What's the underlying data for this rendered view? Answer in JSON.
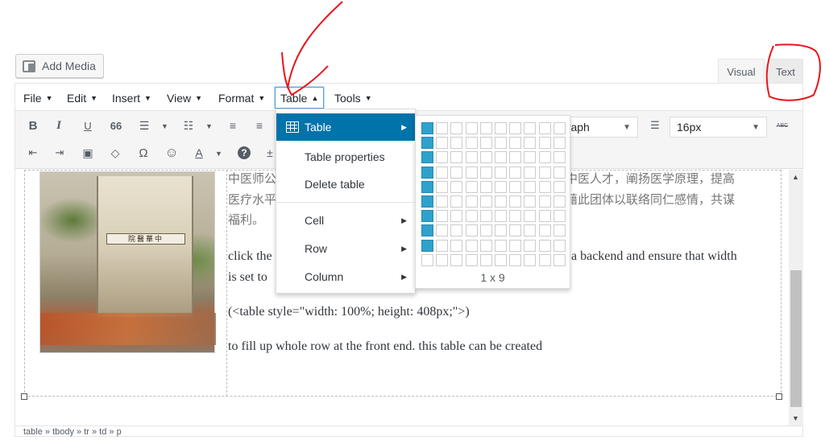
{
  "add_media": {
    "label": "Add Media"
  },
  "tabs": [
    {
      "label": "Visual"
    },
    {
      "label": "Text"
    }
  ],
  "menubar": {
    "items": [
      {
        "label": "File"
      },
      {
        "label": "Edit"
      },
      {
        "label": "Insert"
      },
      {
        "label": "View"
      },
      {
        "label": "Format"
      },
      {
        "label": "Table"
      },
      {
        "label": "Tools"
      }
    ],
    "active": "Table"
  },
  "toolbar": {
    "row1": [
      "bold-icon",
      "italic-icon",
      "underline-icon",
      "blockquote-icon",
      "bullet-list-icon",
      "numbered-list-icon",
      "align-left-icon",
      "align-center-icon"
    ],
    "format_select": "graph",
    "size_select": "16px",
    "row2": [
      "outdent-icon",
      "indent-icon",
      "paste-text-icon",
      "clear-formatting-icon",
      "special-char-icon",
      "emoticon-icon",
      "text-color-icon",
      "help-icon",
      "more-icon"
    ],
    "bold": "B",
    "italic": "I",
    "underline": "U",
    "blockquote": "66",
    "omega": "Ω",
    "emoji": "☺",
    "text_color": "A",
    "help": "?",
    "abc": "ABC"
  },
  "content": {
    "cjk_line1": "中医师公",
    "cjk_line1_right": "医中医人才，阐扬医学原理，提高",
    "cjk_line2": "医疗水平",
    "cjk_line2_right": "并藉此团体以联络同仁感情，共谋",
    "cjk_line3": "福利。",
    "para1_left": "click the",
    "para1_right": "a backend and ensure that width",
    "para2_left": "is set to",
    "para3": "(<table style=\"width: 100%; height: 408px;\">)",
    "para4": "to fill up whole row at the front end. this table can be created",
    "image_sign": "院醫華中"
  },
  "statusbar": {
    "path": "table » tbody » tr » td » p"
  },
  "table_menu": {
    "items": [
      {
        "label": "Table",
        "has_submenu": true
      },
      {
        "label": "Table properties",
        "has_submenu": false
      },
      {
        "label": "Delete table",
        "has_submenu": false
      },
      {
        "label": "Cell",
        "has_submenu": true
      },
      {
        "label": "Row",
        "has_submenu": true
      },
      {
        "label": "Column",
        "has_submenu": true
      }
    ]
  },
  "grid_picker": {
    "cols": 10,
    "rows": 10,
    "selected_cols": 1,
    "selected_rows": 9,
    "label": "1 x 9"
  },
  "colors": {
    "accent": "#0073aa",
    "grid_on": "#2ea2cc",
    "annotation": "#e8151b"
  }
}
